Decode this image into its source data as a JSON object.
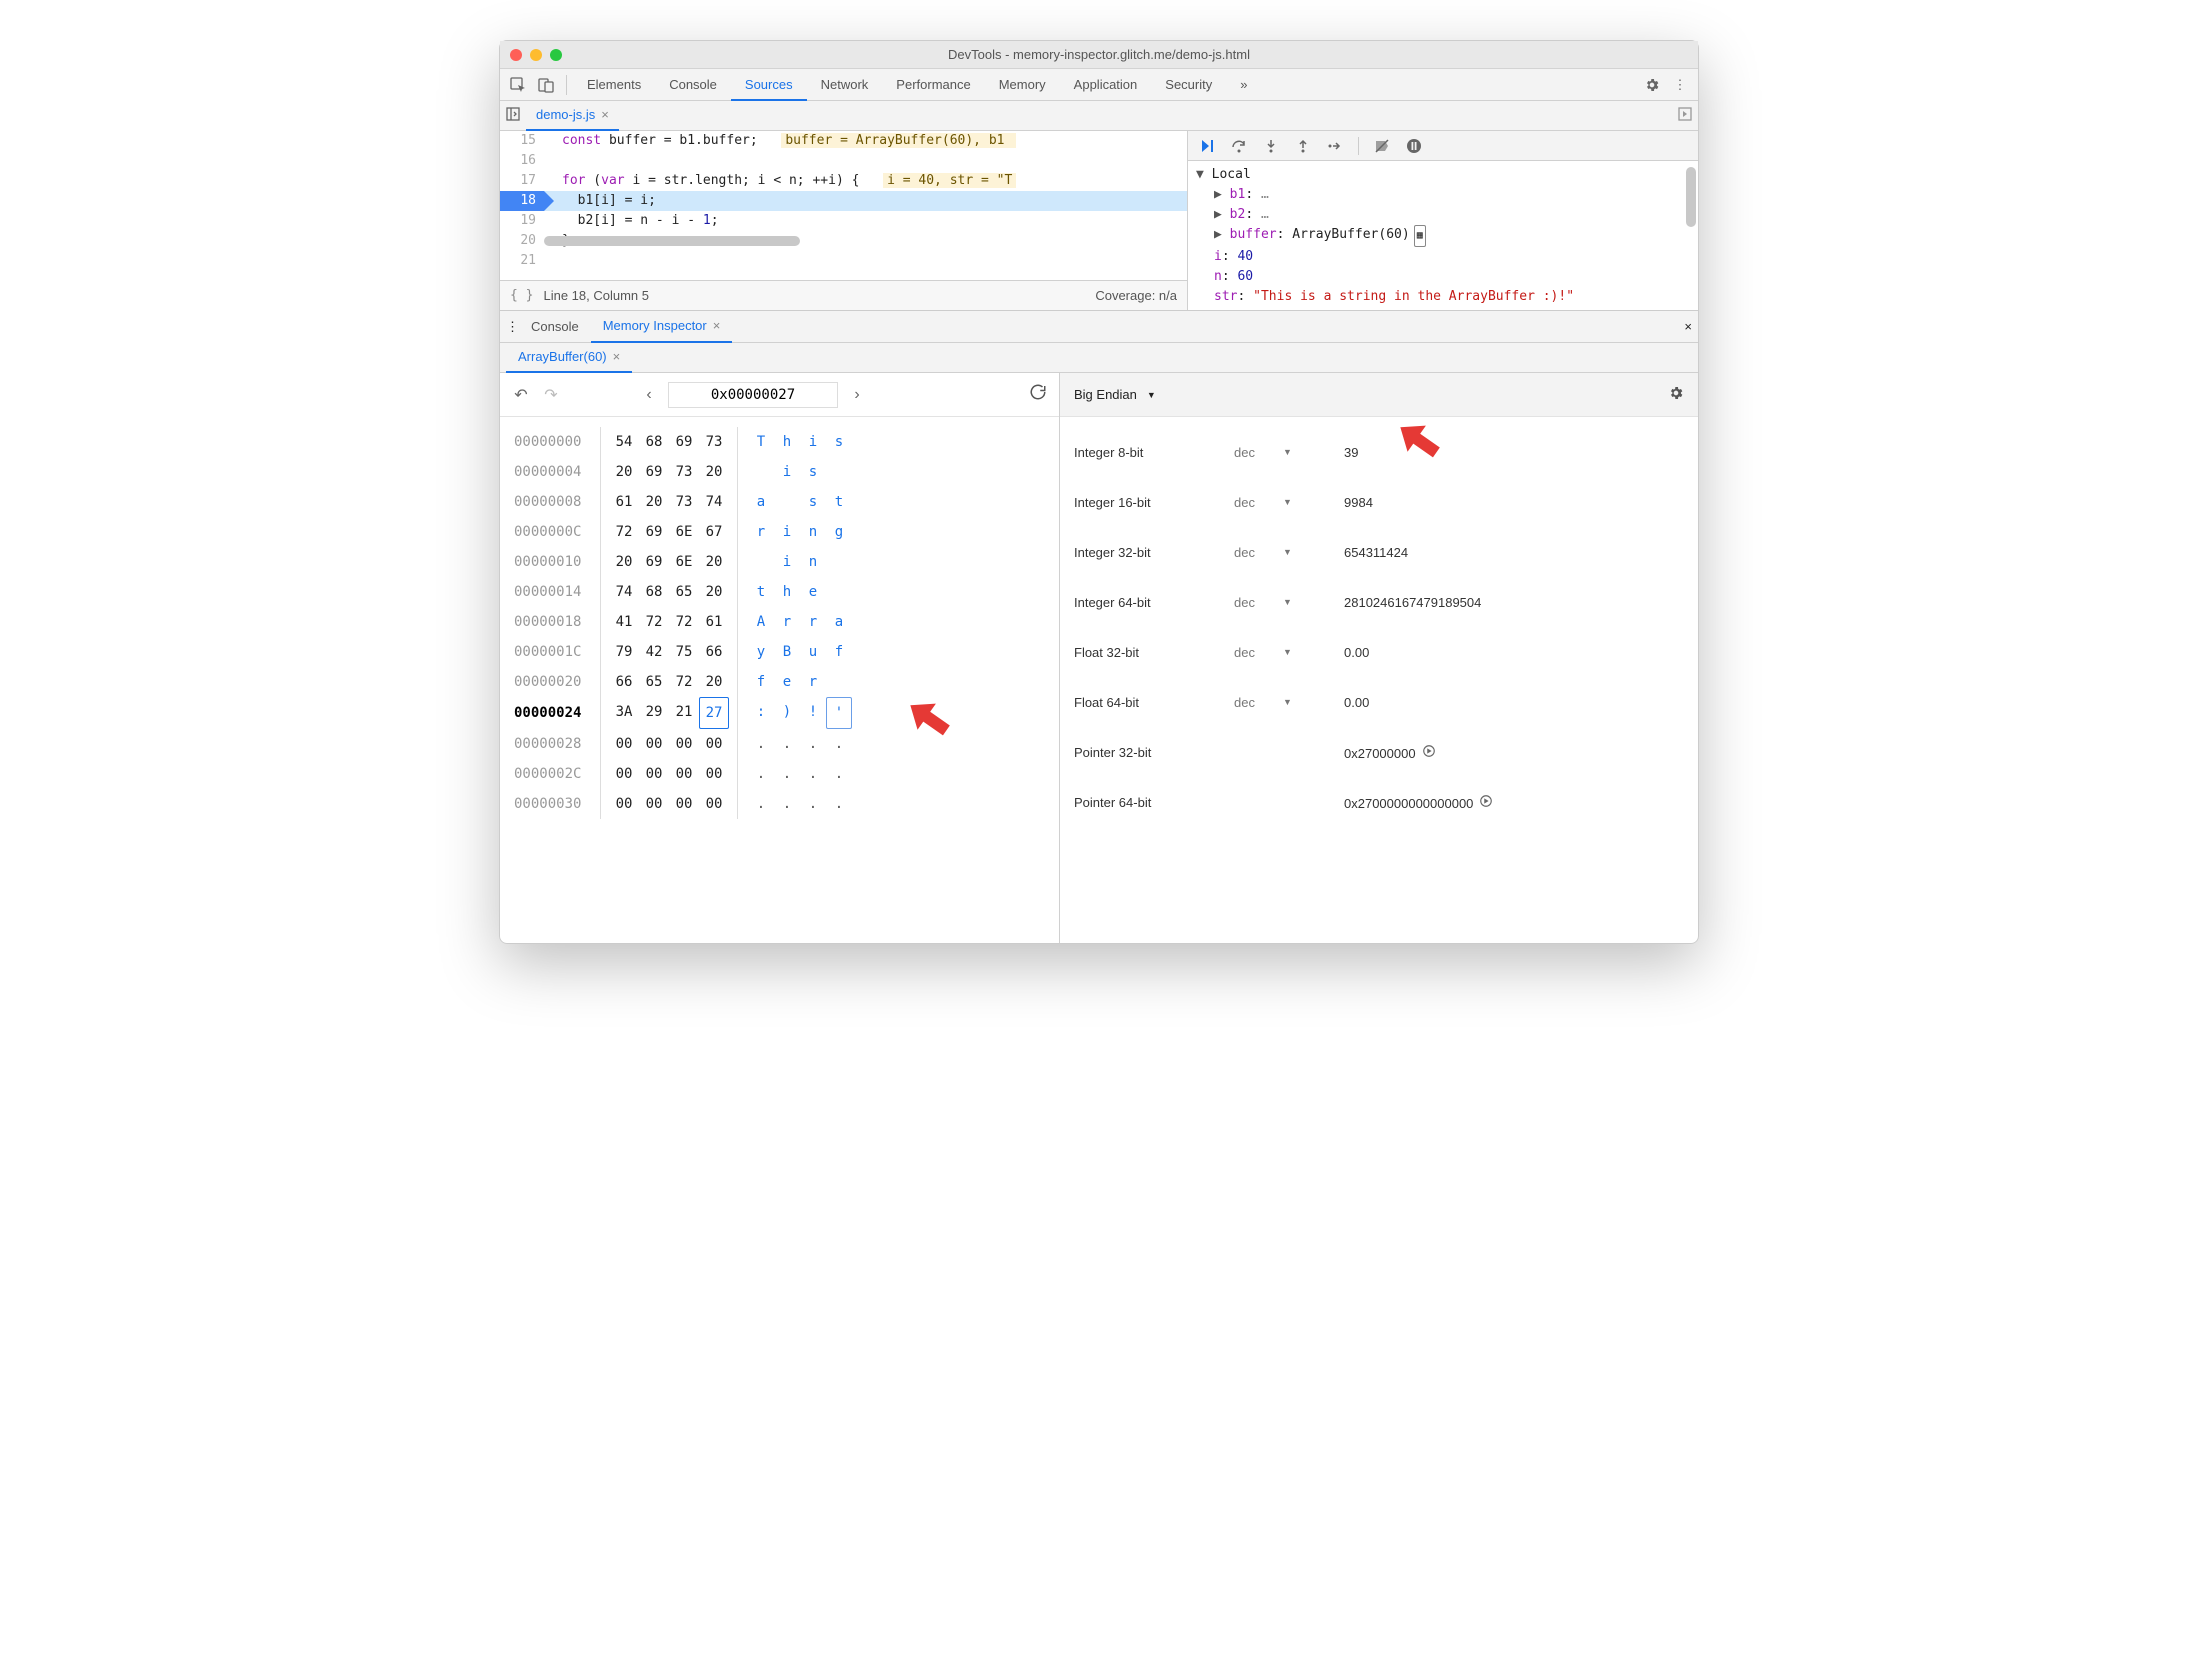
{
  "window": {
    "title": "DevTools - memory-inspector.glitch.me/demo-js.html"
  },
  "main_tabs": {
    "items": [
      "Elements",
      "Console",
      "Sources",
      "Network",
      "Performance",
      "Memory",
      "Application",
      "Security"
    ],
    "active": "Sources",
    "overflow": "»"
  },
  "source": {
    "file_tab": "demo-js.js",
    "lines": {
      "15": "const buffer = b1.buffer;",
      "15_hint": "buffer = ArrayBuffer(60), b1 ",
      "16": "",
      "17": "for (var i = str.length; i < n; ++i) {",
      "17_hint": "i = 40, str = \"T",
      "18": "  b1[i] = i;",
      "19": "  b2[i] = n - i - 1;",
      "20": "}",
      "21": ""
    },
    "status_line": "Line 18, Column 5",
    "coverage": "Coverage: n/a",
    "pretty_icon_name": "pretty-print-icon"
  },
  "scope": {
    "header": "Local",
    "rows": [
      {
        "tw": "▶",
        "key": "b1",
        "sep": ": ",
        "val": "…",
        "cls": "scope-dim"
      },
      {
        "tw": "▶",
        "key": "b2",
        "sep": ": ",
        "val": "…",
        "cls": "scope-dim"
      },
      {
        "tw": "▶",
        "key": "buffer",
        "sep": ": ",
        "val": "ArrayBuffer(60)",
        "cls": "",
        "icon": "memory-chip-icon"
      },
      {
        "tw": " ",
        "key": "i",
        "sep": ": ",
        "val": "40",
        "cls": "scope-val"
      },
      {
        "tw": " ",
        "key": "n",
        "sep": ": ",
        "val": "60",
        "cls": "scope-val"
      },
      {
        "tw": " ",
        "key": "str",
        "sep": ": ",
        "val": "\"This is a string in the ArrayBuffer :)!\"",
        "cls": "scope-str"
      }
    ]
  },
  "drawer": {
    "tabs": [
      "Console",
      "Memory Inspector"
    ],
    "active": "Memory Inspector",
    "buffer_tab": "ArrayBuffer(60)"
  },
  "memory": {
    "address_input": "0x00000027",
    "rows": [
      {
        "addr": "00000000",
        "hex": [
          "54",
          "68",
          "69",
          "73"
        ],
        "txt": [
          "T",
          "h",
          "i",
          "s"
        ]
      },
      {
        "addr": "00000004",
        "hex": [
          "20",
          "69",
          "73",
          "20"
        ],
        "txt": [
          " ",
          "i",
          "s",
          " "
        ]
      },
      {
        "addr": "00000008",
        "hex": [
          "61",
          "20",
          "73",
          "74"
        ],
        "txt": [
          "a",
          " ",
          "s",
          "t"
        ]
      },
      {
        "addr": "0000000C",
        "hex": [
          "72",
          "69",
          "6E",
          "67"
        ],
        "txt": [
          "r",
          "i",
          "n",
          "g"
        ]
      },
      {
        "addr": "00000010",
        "hex": [
          "20",
          "69",
          "6E",
          "20"
        ],
        "txt": [
          " ",
          "i",
          "n",
          " "
        ]
      },
      {
        "addr": "00000014",
        "hex": [
          "74",
          "68",
          "65",
          "20"
        ],
        "txt": [
          "t",
          "h",
          "e",
          " "
        ]
      },
      {
        "addr": "00000018",
        "hex": [
          "41",
          "72",
          "72",
          "61"
        ],
        "txt": [
          "A",
          "r",
          "r",
          "a"
        ]
      },
      {
        "addr": "0000001C",
        "hex": [
          "79",
          "42",
          "75",
          "66"
        ],
        "txt": [
          "y",
          "B",
          "u",
          "f"
        ]
      },
      {
        "addr": "00000020",
        "hex": [
          "66",
          "65",
          "72",
          "20"
        ],
        "txt": [
          "f",
          "e",
          "r",
          " "
        ]
      },
      {
        "addr": "00000024",
        "hex": [
          "3A",
          "29",
          "21",
          "27"
        ],
        "txt": [
          ":",
          ")",
          "!",
          "'"
        ],
        "current": true,
        "sel": 3
      },
      {
        "addr": "00000028",
        "hex": [
          "00",
          "00",
          "00",
          "00"
        ],
        "txt": [
          ".",
          ".",
          ".",
          "."
        ],
        "dim": true
      },
      {
        "addr": "0000002C",
        "hex": [
          "00",
          "00",
          "00",
          "00"
        ],
        "txt": [
          ".",
          ".",
          ".",
          "."
        ],
        "dim": true
      },
      {
        "addr": "00000030",
        "hex": [
          "00",
          "00",
          "00",
          "00"
        ],
        "txt": [
          ".",
          ".",
          ".",
          "."
        ],
        "dim": true
      }
    ]
  },
  "values": {
    "endian": "Big Endian",
    "rows": [
      {
        "label": "Integer 8-bit",
        "fmt": "dec",
        "val": "39"
      },
      {
        "label": "Integer 16-bit",
        "fmt": "dec",
        "val": "9984"
      },
      {
        "label": "Integer 32-bit",
        "fmt": "dec",
        "val": "654311424"
      },
      {
        "label": "Integer 64-bit",
        "fmt": "dec",
        "val": "2810246167479189504"
      },
      {
        "label": "Float 32-bit",
        "fmt": "dec",
        "val": "0.00"
      },
      {
        "label": "Float 64-bit",
        "fmt": "dec",
        "val": "0.00"
      },
      {
        "label": "Pointer 32-bit",
        "fmt": "",
        "val": "0x27000000",
        "jump": true
      },
      {
        "label": "Pointer 64-bit",
        "fmt": "",
        "val": "0x2700000000000000",
        "jump": true
      }
    ]
  }
}
